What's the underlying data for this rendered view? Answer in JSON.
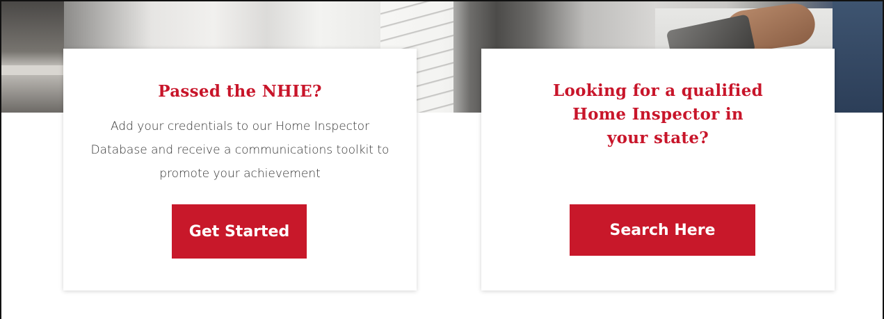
{
  "cards": [
    {
      "title": "Passed the NHIE?",
      "description": "Add your credentials to our Home Inspector Database and receive a communications toolkit to promote your achievement",
      "button_label": "Get Started"
    },
    {
      "title_lines": [
        "Looking for a qualified",
        "Home Inspector in",
        "your state?"
      ],
      "button_label": "Search Here"
    }
  ],
  "colors": {
    "accent": "#c8182a",
    "title": "#c8152a",
    "body_text": "#333333",
    "card_bg": "#ffffff"
  }
}
